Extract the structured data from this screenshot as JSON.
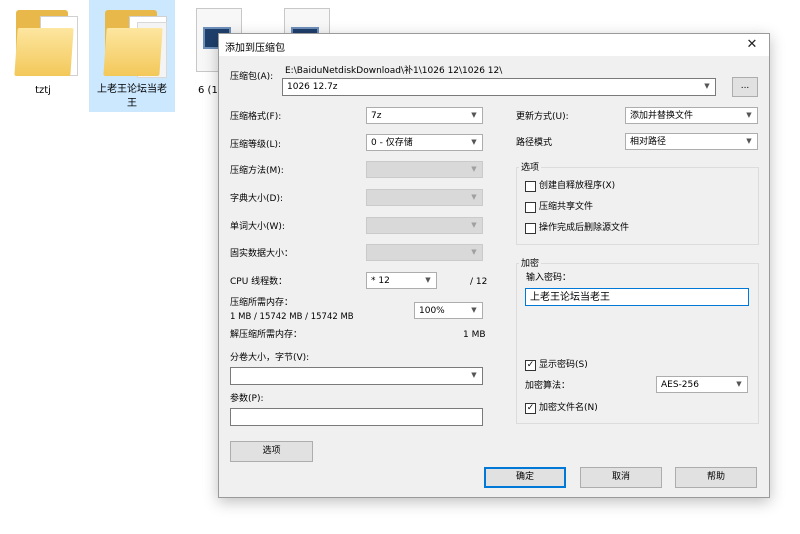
{
  "explorer": {
    "items": [
      {
        "label": "tztj"
      },
      {
        "label": "上老王论坛当老王"
      },
      {
        "label": "6 (1"
      },
      {
        "label": ""
      }
    ]
  },
  "dialog": {
    "title": "添加到压缩包",
    "archive_label": "压缩包(A):",
    "archive_path": "E:\\BaiduNetdiskDownload\\补1\\1026 12\\1026 12\\",
    "archive_name": "1026 12.7z",
    "browse_label": "...",
    "format_label": "压缩格式(F):",
    "format_value": "7z",
    "level_label": "压缩等级(L):",
    "level_value": "0 - 仅存储",
    "method_label": "压缩方法(M):",
    "dict_label": "字典大小(D):",
    "word_label": "单词大小(W):",
    "solid_label": "固实数据大小：",
    "cpu_label": "CPU 线程数：",
    "cpu_value": "* 12",
    "cpu_total": "/ 12",
    "mem_compress_label": "压缩所需内存：",
    "mem_compress_value": "1 MB / 15742 MB / 15742 MB",
    "mem_percent": "100%",
    "mem_decompress_label": "解压缩所需内存：",
    "mem_decompress_value": "1 MB",
    "split_label": "分卷大小，字节(V):",
    "split_value": "",
    "params_label": "参数(P):",
    "params_value": "",
    "options_button": "选项",
    "update_label": "更新方式(U):",
    "update_value": "添加并替换文件",
    "path_label": "路径模式",
    "path_value": "相对路径",
    "options_group": "选项",
    "opt_sfx": "创建自释放程序(X)",
    "opt_shared": "压缩共享文件",
    "opt_delete": "操作完成后删除源文件",
    "encrypt_group": "加密",
    "password_label": "输入密码：",
    "password_value": "上老王论坛当老王",
    "show_password": "显示密码(S)",
    "encrypt_method_label": "加密算法：",
    "encrypt_method_value": "AES-256",
    "encrypt_names": "加密文件名(N)",
    "ok": "确定",
    "cancel": "取消",
    "help": "帮助"
  },
  "colors": {
    "accent": "#0078d7",
    "selection": "#cce8ff",
    "folder": "#f3c85a"
  }
}
